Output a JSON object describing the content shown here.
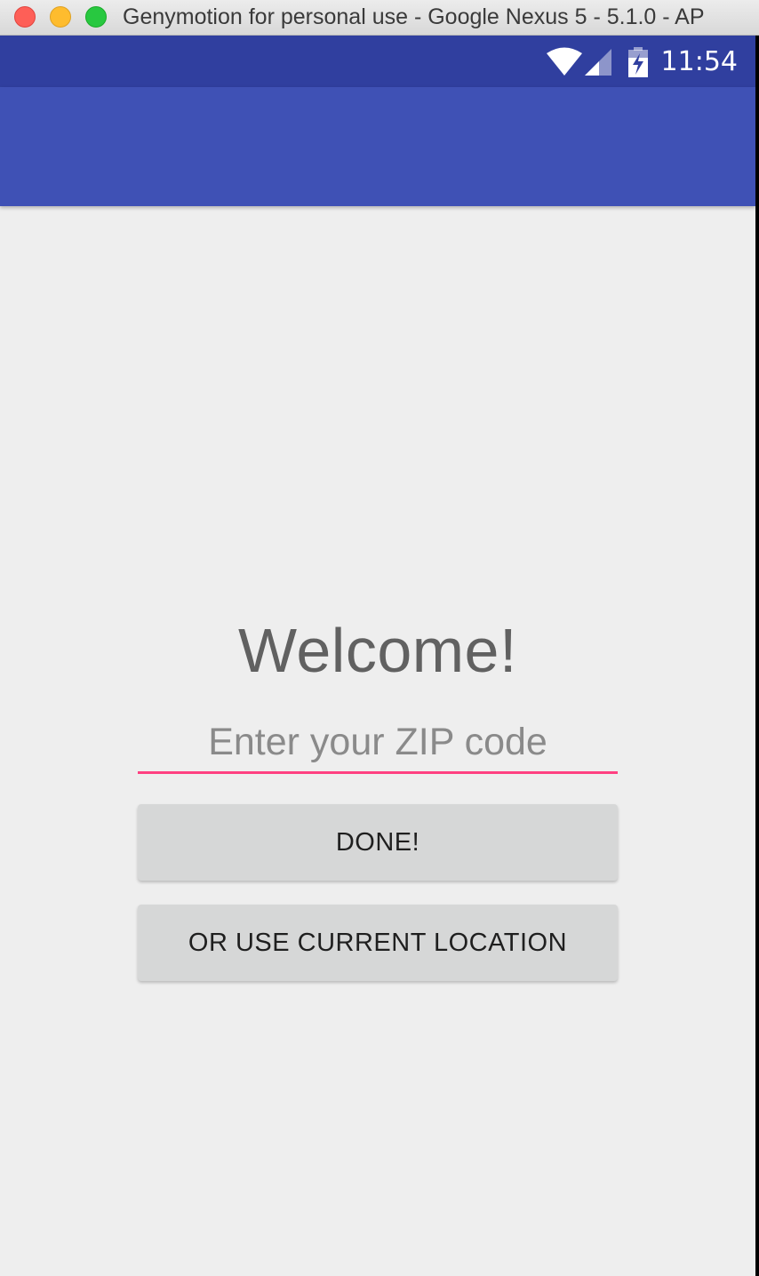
{
  "window": {
    "title": "Genymotion for personal use - Google Nexus 5 - 5.1.0 - AP"
  },
  "statusbar": {
    "time": "11:54",
    "icons": [
      "wifi-icon",
      "cell-signal-icon",
      "battery-charging-icon"
    ]
  },
  "colors": {
    "status_bar": "#303f9f",
    "app_bar": "#3f51b5",
    "accent": "#ff4081",
    "background": "#eeeeee",
    "button": "#d6d7d7"
  },
  "main": {
    "welcome": "Welcome!",
    "zip_input": {
      "value": "",
      "placeholder": "Enter your ZIP code"
    },
    "done_button": "DONE!",
    "location_button": "OR USE CURRENT LOCATION"
  }
}
